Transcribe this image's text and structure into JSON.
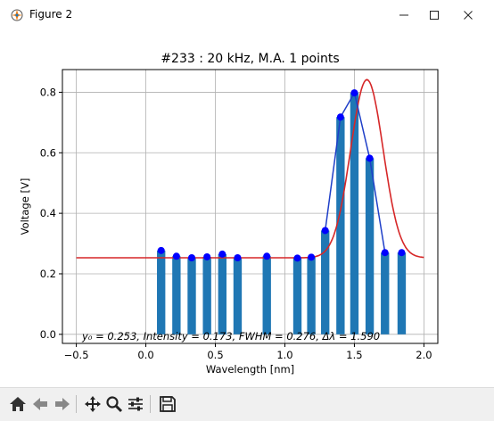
{
  "window": {
    "title": "Figure 2",
    "minimize_icon": "minimize-icon",
    "maximize_icon": "maximize-icon",
    "close_icon": "close-icon"
  },
  "toolbar": {
    "buttons": [
      {
        "name": "home-button",
        "icon": "home-icon"
      },
      {
        "name": "back-button",
        "icon": "arrow-left-icon"
      },
      {
        "name": "forward-button",
        "icon": "arrow-right-icon"
      },
      {
        "name": "pan-button",
        "icon": "move-icon"
      },
      {
        "name": "zoom-button",
        "icon": "zoom-icon"
      },
      {
        "name": "configure-subplots-button",
        "icon": "sliders-icon"
      },
      {
        "name": "save-button",
        "icon": "save-icon"
      }
    ]
  },
  "chart_data": {
    "type": "bar",
    "title": "#233 : 20 kHz, M.A. 1 points",
    "xlabel": "Wavelength [nm]",
    "ylabel": "Voltage [V]",
    "xlim": [
      -0.6,
      2.1
    ],
    "ylim": [
      -0.03,
      0.875
    ],
    "xticks": [
      -0.5,
      0.0,
      0.5,
      1.0,
      1.5,
      2.0
    ],
    "xtick_labels": [
      "−0.5",
      "0.0",
      "0.5",
      "1.0",
      "1.5",
      "2.0"
    ],
    "yticks": [
      0.0,
      0.2,
      0.4,
      0.6,
      0.8
    ],
    "ytick_labels": [
      "0.0",
      "0.2",
      "0.4",
      "0.6",
      "0.8"
    ],
    "grid": true,
    "bar_width": 0.06,
    "bar_color": "#1f77b4",
    "point_color": "#0000ff",
    "fit_color": "#d62728",
    "data_line_color": "#1f3fc8",
    "x": [
      0.11,
      0.22,
      0.33,
      0.44,
      0.55,
      0.66,
      0.87,
      1.09,
      1.19,
      1.29,
      1.4,
      1.5,
      1.61,
      1.72,
      1.84
    ],
    "values": [
      0.277,
      0.258,
      0.253,
      0.256,
      0.265,
      0.253,
      0.258,
      0.252,
      0.255,
      0.343,
      0.718,
      0.798,
      0.582,
      0.27,
      0.27
    ],
    "fit": {
      "model": "gaussian",
      "y0": 0.253,
      "intensity": 0.173,
      "fwhm": 0.276,
      "center": 1.59,
      "x_range": [
        -0.5,
        2.0
      ]
    },
    "annotation": "y₀ = 0.253, Intensity = 0.173, FWHM = 0.276, Δλ = 1.590"
  }
}
